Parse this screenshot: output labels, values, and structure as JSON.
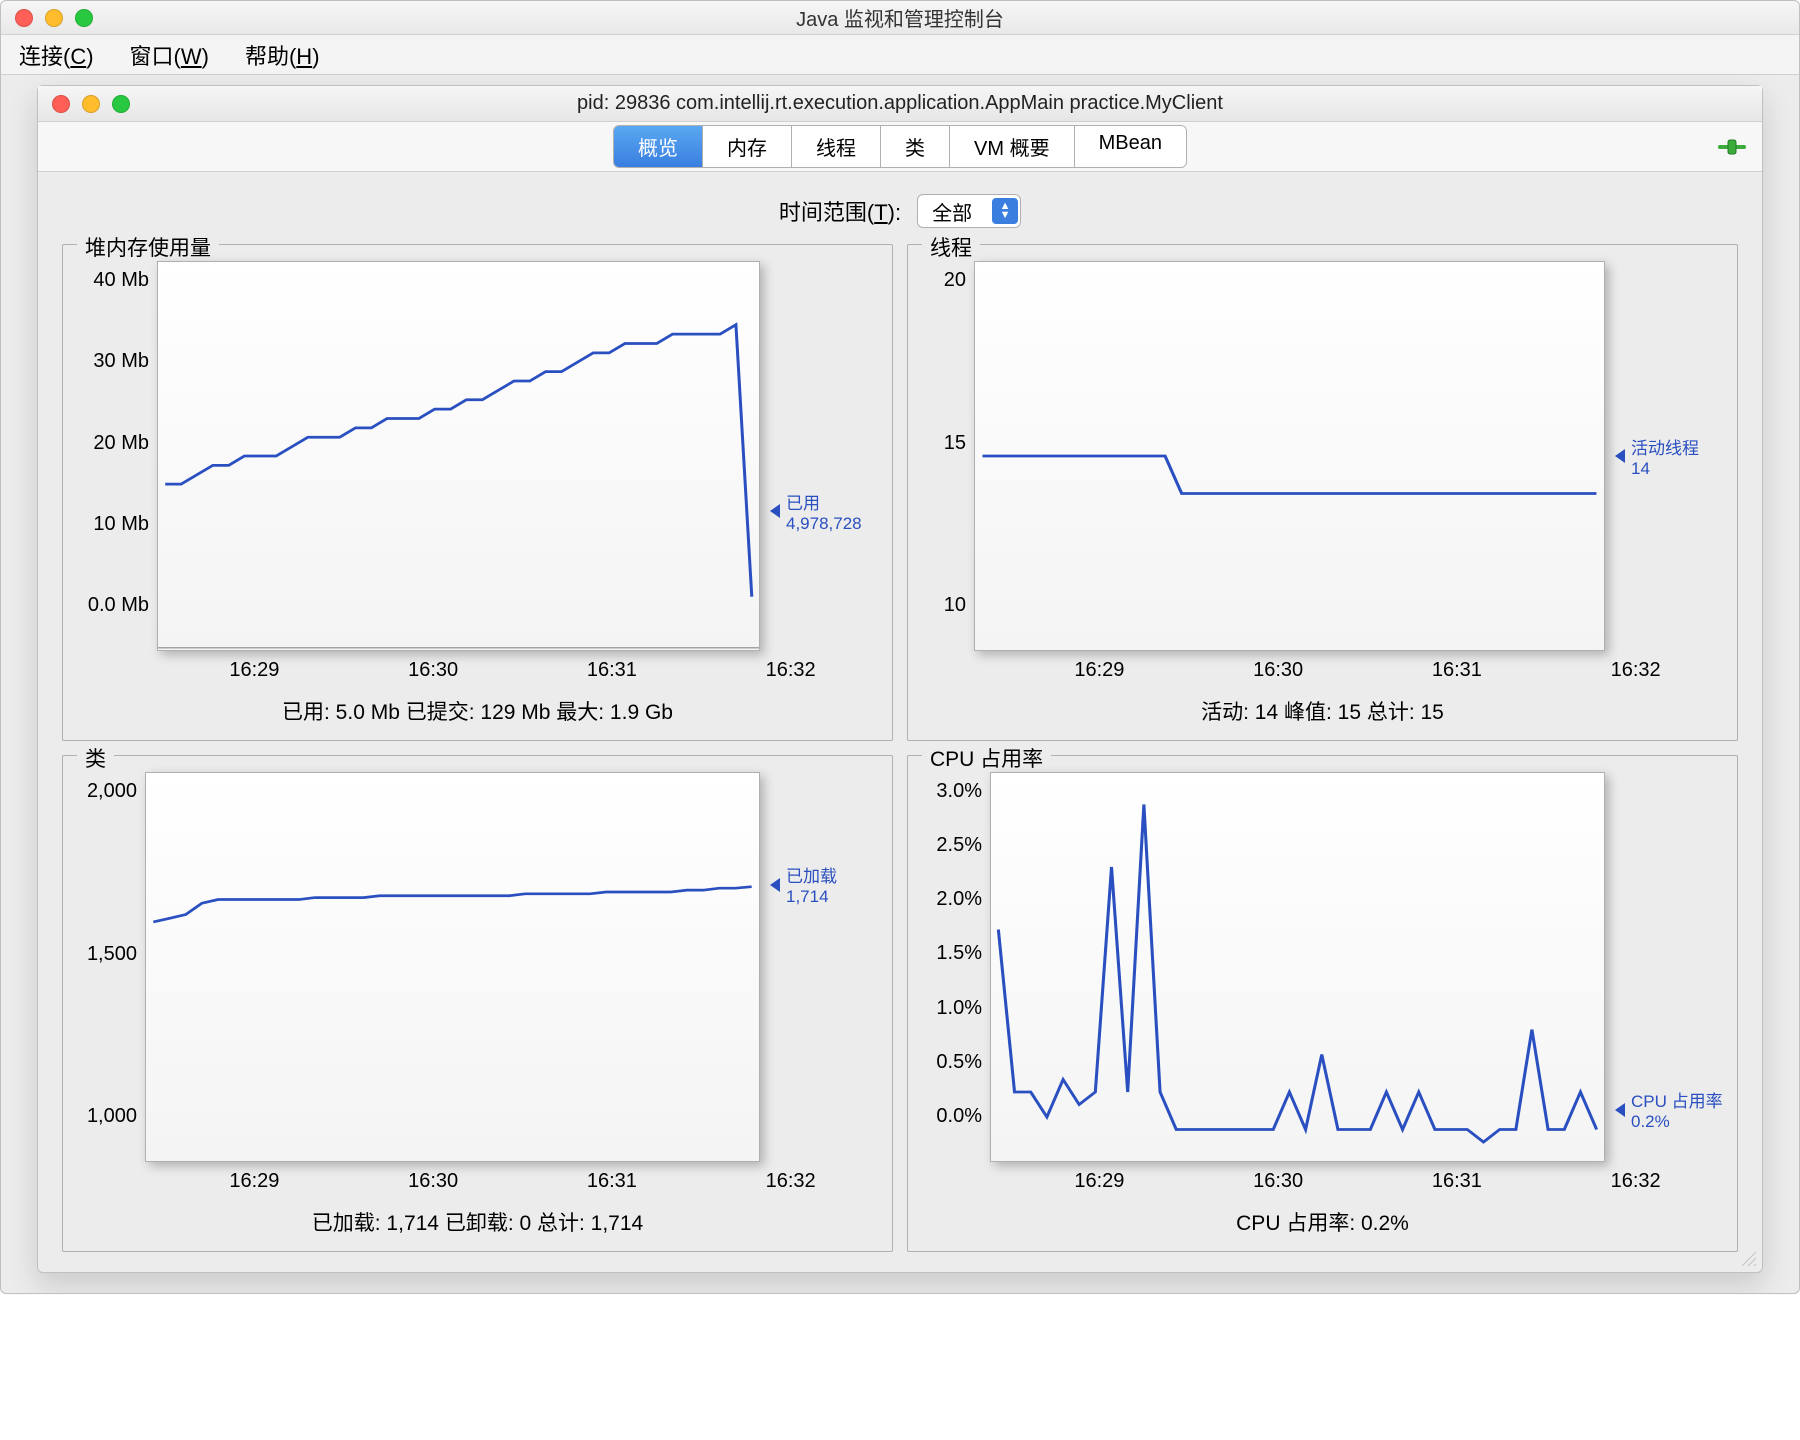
{
  "app_title": "Java 监视和管理控制台",
  "menu": {
    "connect": "连接(C)",
    "window": "窗口(W)",
    "help": "帮助(H)"
  },
  "connection_title": "pid: 29836 com.intellij.rt.execution.application.AppMain practice.MyClient",
  "tabs": {
    "overview": "概览",
    "memory": "内存",
    "threads": "线程",
    "classes": "类",
    "vm_summary": "VM 概要",
    "mbean": "MBean"
  },
  "time_range": {
    "label": "时间范围(T):",
    "value": "全部"
  },
  "charts": {
    "heap": {
      "title": "堆内存使用量",
      "callout_label": "已用",
      "callout_value": "4,978,728",
      "stats": "已用: 5.0 Mb    已提交: 129 Mb    最大: 1.9 Gb"
    },
    "threads": {
      "title": "线程",
      "callout_label": "活动线程",
      "callout_value": "14",
      "stats": "活动: 14    峰值: 15    总计: 15"
    },
    "classes": {
      "title": "类",
      "callout_label": "已加载",
      "callout_value": "1,714",
      "stats": "已加载: 1,714    已卸载: 0    总计: 1,714"
    },
    "cpu": {
      "title": "CPU 占用率",
      "callout_label": "CPU 占用率",
      "callout_value": "0.2%",
      "stats": "CPU 占用率: 0.2%"
    }
  },
  "chart_data": [
    {
      "type": "line",
      "title": "堆内存使用量",
      "xlabel": "",
      "ylabel": "Mb",
      "ylim": [
        0,
        40
      ],
      "x_categories": [
        "16:29",
        "16:30",
        "16:31",
        "16:32"
      ],
      "series": [
        {
          "name": "已用",
          "values": [
            17,
            17,
            18,
            19,
            19,
            20,
            20,
            20,
            21,
            22,
            22,
            22,
            23,
            23,
            24,
            24,
            24,
            25,
            25,
            26,
            26,
            27,
            28,
            28,
            29,
            29,
            30,
            31,
            31,
            32,
            32,
            32,
            33,
            33,
            33,
            33,
            34,
            5
          ]
        }
      ],
      "annotations": [
        {
          "label": "已用",
          "value": "4,978,728"
        }
      ]
    },
    {
      "type": "line",
      "title": "线程",
      "ylim": [
        10,
        20
      ],
      "x_categories": [
        "16:29",
        "16:30",
        "16:31",
        "16:32"
      ],
      "series": [
        {
          "name": "活动线程",
          "values": [
            15,
            15,
            15,
            15,
            15,
            15,
            15,
            15,
            15,
            15,
            15,
            15,
            14,
            14,
            14,
            14,
            14,
            14,
            14,
            14,
            14,
            14,
            14,
            14,
            14,
            14,
            14,
            14,
            14,
            14,
            14,
            14,
            14,
            14,
            14,
            14,
            14,
            14
          ]
        }
      ],
      "annotations": [
        {
          "label": "活动线程",
          "value": "14"
        }
      ]
    },
    {
      "type": "line",
      "title": "类",
      "ylim": [
        1000,
        2000
      ],
      "x_categories": [
        "16:29",
        "16:30",
        "16:31",
        "16:32"
      ],
      "series": [
        {
          "name": "已加载",
          "values": [
            1620,
            1630,
            1640,
            1670,
            1680,
            1680,
            1680,
            1680,
            1680,
            1680,
            1685,
            1685,
            1685,
            1685,
            1690,
            1690,
            1690,
            1690,
            1690,
            1690,
            1690,
            1690,
            1690,
            1695,
            1695,
            1695,
            1695,
            1695,
            1700,
            1700,
            1700,
            1700,
            1700,
            1705,
            1705,
            1710,
            1710,
            1714
          ]
        }
      ],
      "annotations": [
        {
          "label": "已加载",
          "value": "1,714"
        }
      ]
    },
    {
      "type": "line",
      "title": "CPU 占用率",
      "ylim": [
        0,
        3.0
      ],
      "ylabel": "%",
      "x_categories": [
        "16:29",
        "16:30",
        "16:31",
        "16:32"
      ],
      "series": [
        {
          "name": "CPU 占用率",
          "values": [
            1.8,
            0.5,
            0.5,
            0.3,
            0.6,
            0.4,
            0.5,
            2.3,
            0.5,
            2.8,
            0.5,
            0.2,
            0.2,
            0.2,
            0.2,
            0.2,
            0.2,
            0.2,
            0.5,
            0.2,
            0.8,
            0.2,
            0.2,
            0.2,
            0.5,
            0.2,
            0.5,
            0.2,
            0.2,
            0.2,
            0.1,
            0.2,
            0.2,
            1.0,
            0.2,
            0.2,
            0.5,
            0.2
          ]
        }
      ],
      "annotations": [
        {
          "label": "CPU 占用率",
          "value": "0.2%"
        }
      ]
    }
  ]
}
